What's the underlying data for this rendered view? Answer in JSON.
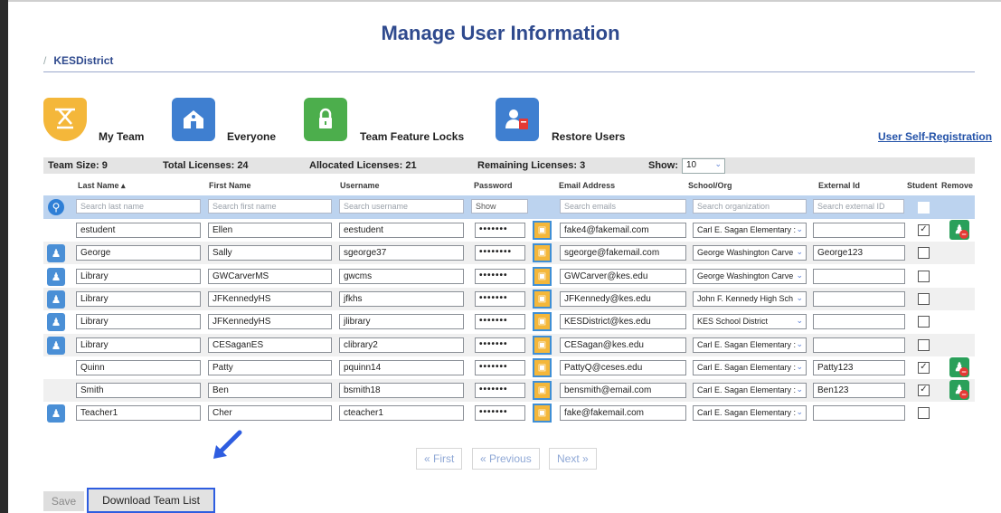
{
  "page": {
    "title": "Manage User Information",
    "breadcrumb_sep": "/",
    "breadcrumb": "KESDistrict"
  },
  "nav": [
    {
      "label": "My Team",
      "icon": "my-team-icon",
      "color": "#f4b73a"
    },
    {
      "label": "Everyone",
      "icon": "school-icon",
      "color": "#3f7fd0"
    },
    {
      "label": "Team Feature Locks",
      "icon": "lock-icon",
      "color": "#4cae4c"
    },
    {
      "label": "Restore Users",
      "icon": "restore-users-icon",
      "color": "#3f7fd0"
    }
  ],
  "self_registration": "User Self-Registration",
  "status": {
    "team_size": "Team Size: 9",
    "total": "Total Licenses: 24",
    "allocated": "Allocated Licenses: 21",
    "remaining": "Remaining Licenses: 3",
    "show_label": "Show:",
    "show_value": "10"
  },
  "columns": {
    "last": "Last Name ▴",
    "first": "First Name",
    "user": "Username",
    "pass": "Password",
    "email": "Email Address",
    "org": "School/Org",
    "ext": "External Id",
    "student": "Student",
    "remove": "Remove"
  },
  "search": {
    "last": "Search last name",
    "first": "Search first name",
    "user": "Search username",
    "pass": "Show",
    "email": "Search emails",
    "org": "Search organization",
    "ext": "Search external ID"
  },
  "rows": [
    {
      "last": "estudent",
      "first": "Ellen",
      "user": "eestudent",
      "pass": "•••••••",
      "email": "fake4@fakemail.com",
      "org": "Carl E. Sagan Elementary :",
      "ext": "",
      "student": true,
      "remove": true,
      "icon": false
    },
    {
      "last": "George",
      "first": "Sally",
      "user": "sgeorge37",
      "pass": "••••••••",
      "email": "sgeorge@fakemail.com",
      "org": "George Washington Carve",
      "ext": "George123",
      "student": false,
      "remove": false,
      "icon": true
    },
    {
      "last": "Library",
      "first": "GWCarverMS",
      "user": "gwcms",
      "pass": "•••••••",
      "email": "GWCarver@kes.edu",
      "org": "George Washington Carve",
      "ext": "",
      "student": false,
      "remove": false,
      "icon": true
    },
    {
      "last": "Library",
      "first": "JFKennedyHS",
      "user": "jfkhs",
      "pass": "•••••••",
      "email": "JFKennedy@kes.edu",
      "org": "John F. Kennedy High Sch",
      "ext": "",
      "student": false,
      "remove": false,
      "icon": true
    },
    {
      "last": "Library",
      "first": "JFKennedyHS",
      "user": "jlibrary",
      "pass": "•••••••",
      "email": "KESDistrict@kes.edu",
      "org": "KES School District",
      "ext": "",
      "student": false,
      "remove": false,
      "icon": true
    },
    {
      "last": "Library",
      "first": "CESaganES",
      "user": "clibrary2",
      "pass": "•••••••",
      "email": "CESagan@kes.edu",
      "org": "Carl E. Sagan Elementary :",
      "ext": "",
      "student": false,
      "remove": false,
      "icon": true
    },
    {
      "last": "Quinn",
      "first": "Patty",
      "user": "pquinn14",
      "pass": "•••••••",
      "email": "PattyQ@ceses.edu",
      "org": "Carl E. Sagan Elementary :",
      "ext": "Patty123",
      "student": true,
      "remove": true,
      "icon": false
    },
    {
      "last": "Smith",
      "first": "Ben",
      "user": "bsmith18",
      "pass": "•••••••",
      "email": "bensmith@email.com",
      "org": "Carl E. Sagan Elementary :",
      "ext": "Ben123",
      "student": true,
      "remove": true,
      "icon": false
    },
    {
      "last": "Teacher1",
      "first": "Cher",
      "user": "cteacher1",
      "pass": "•••••••",
      "email": "fake@fakemail.com",
      "org": "Carl E. Sagan Elementary :",
      "ext": "",
      "student": false,
      "remove": false,
      "icon": true
    }
  ],
  "pager": {
    "first": "« First",
    "prev": "« Previous",
    "next": "Next »"
  },
  "buttons": {
    "save": "Save",
    "download": "Download Team List"
  }
}
